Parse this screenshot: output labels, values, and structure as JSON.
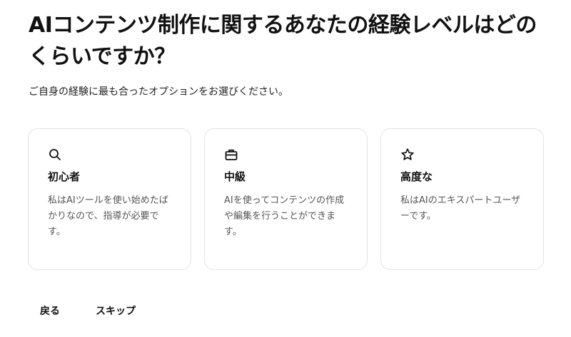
{
  "question": {
    "title": "AIコンテンツ制作に関するあなたの経験レベルはどのくらいですか？",
    "subtitle": "ご自身の経験に最も合ったオプションをお選びください。"
  },
  "options": [
    {
      "icon": "search-icon",
      "title": "初心者",
      "description": "私はAIツールを使い始めたばかりなので、指導が必要です。"
    },
    {
      "icon": "briefcase-icon",
      "title": "中級",
      "description": "AIを使ってコンテンツの作成や編集を行うことができます。"
    },
    {
      "icon": "star-icon",
      "title": "高度な",
      "description": "私はAIのエキスパートユーザーです。"
    }
  ],
  "footer": {
    "back_label": "戻る",
    "skip_label": "スキップ"
  },
  "colors": {
    "text": "#111111",
    "muted_text": "#555555",
    "card_border": "#e2e2e2",
    "background": "#ffffff"
  }
}
